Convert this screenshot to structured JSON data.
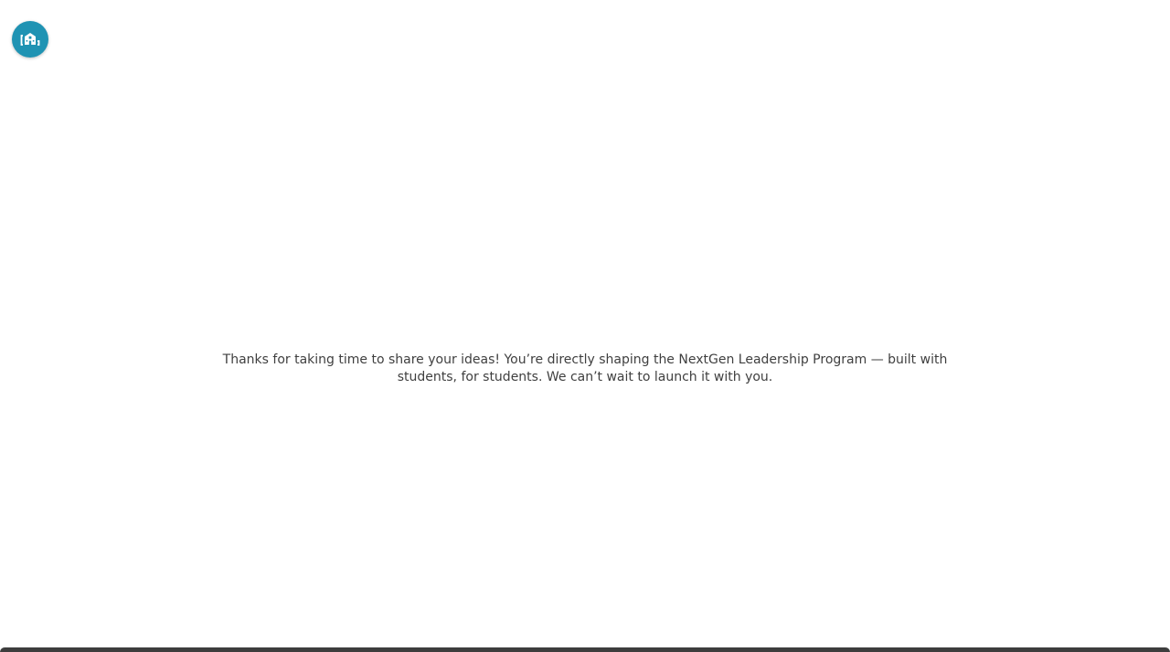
{
  "app": {
    "logo_icon": "building-chat-icon",
    "brand_color": "#1f93b3"
  },
  "message": {
    "text": "Thanks for taking  time to share your ideas! You’re directly shaping the NextGen Leadership Program — built with students, for students. We can’t wait to launch it with you."
  },
  "footer": {
    "bar_color": "#3d3d3d"
  }
}
